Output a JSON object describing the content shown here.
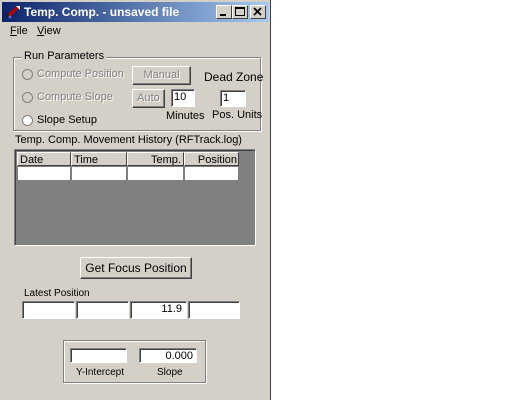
{
  "window": {
    "title": "Temp. Comp. - unsaved file",
    "icon": "app-icon",
    "controls": [
      "minimize-icon",
      "maximize-icon",
      "close-icon"
    ]
  },
  "menu": {
    "file": "File",
    "view": "View"
  },
  "run_parameters": {
    "group_label": "Run Parameters",
    "compute_position": "Compute Position",
    "compute_slope": "Compute Slope",
    "slope_setup": "Slope Setup",
    "manual_button": "Manual",
    "auto_button": "Auto",
    "minutes_value": "10",
    "minutes_label": "Minutes",
    "dead_zone_label": "Dead Zone",
    "dead_zone_value": "1",
    "pos_units_label": "Pos. Units"
  },
  "history": {
    "label": "Temp. Comp. Movement History (RFTrack.log)",
    "columns": [
      "Date",
      "Time",
      "Temp.",
      "Position"
    ],
    "rows": [
      [
        "",
        "",
        "",
        ""
      ]
    ]
  },
  "get_focus_button": "Get Focus Position",
  "latest_position": {
    "label": "Latest Position",
    "values": [
      "",
      "",
      "11.9",
      ""
    ]
  },
  "fit": {
    "y_intercept_value": "",
    "y_intercept_label": "Y-Intercept",
    "slope_value": "0.000",
    "slope_label": "Slope"
  },
  "colors": {
    "face": "#d4d0c8",
    "title_start": "#0a246a",
    "title_end": "#a6caf0",
    "shadow": "#808080"
  }
}
